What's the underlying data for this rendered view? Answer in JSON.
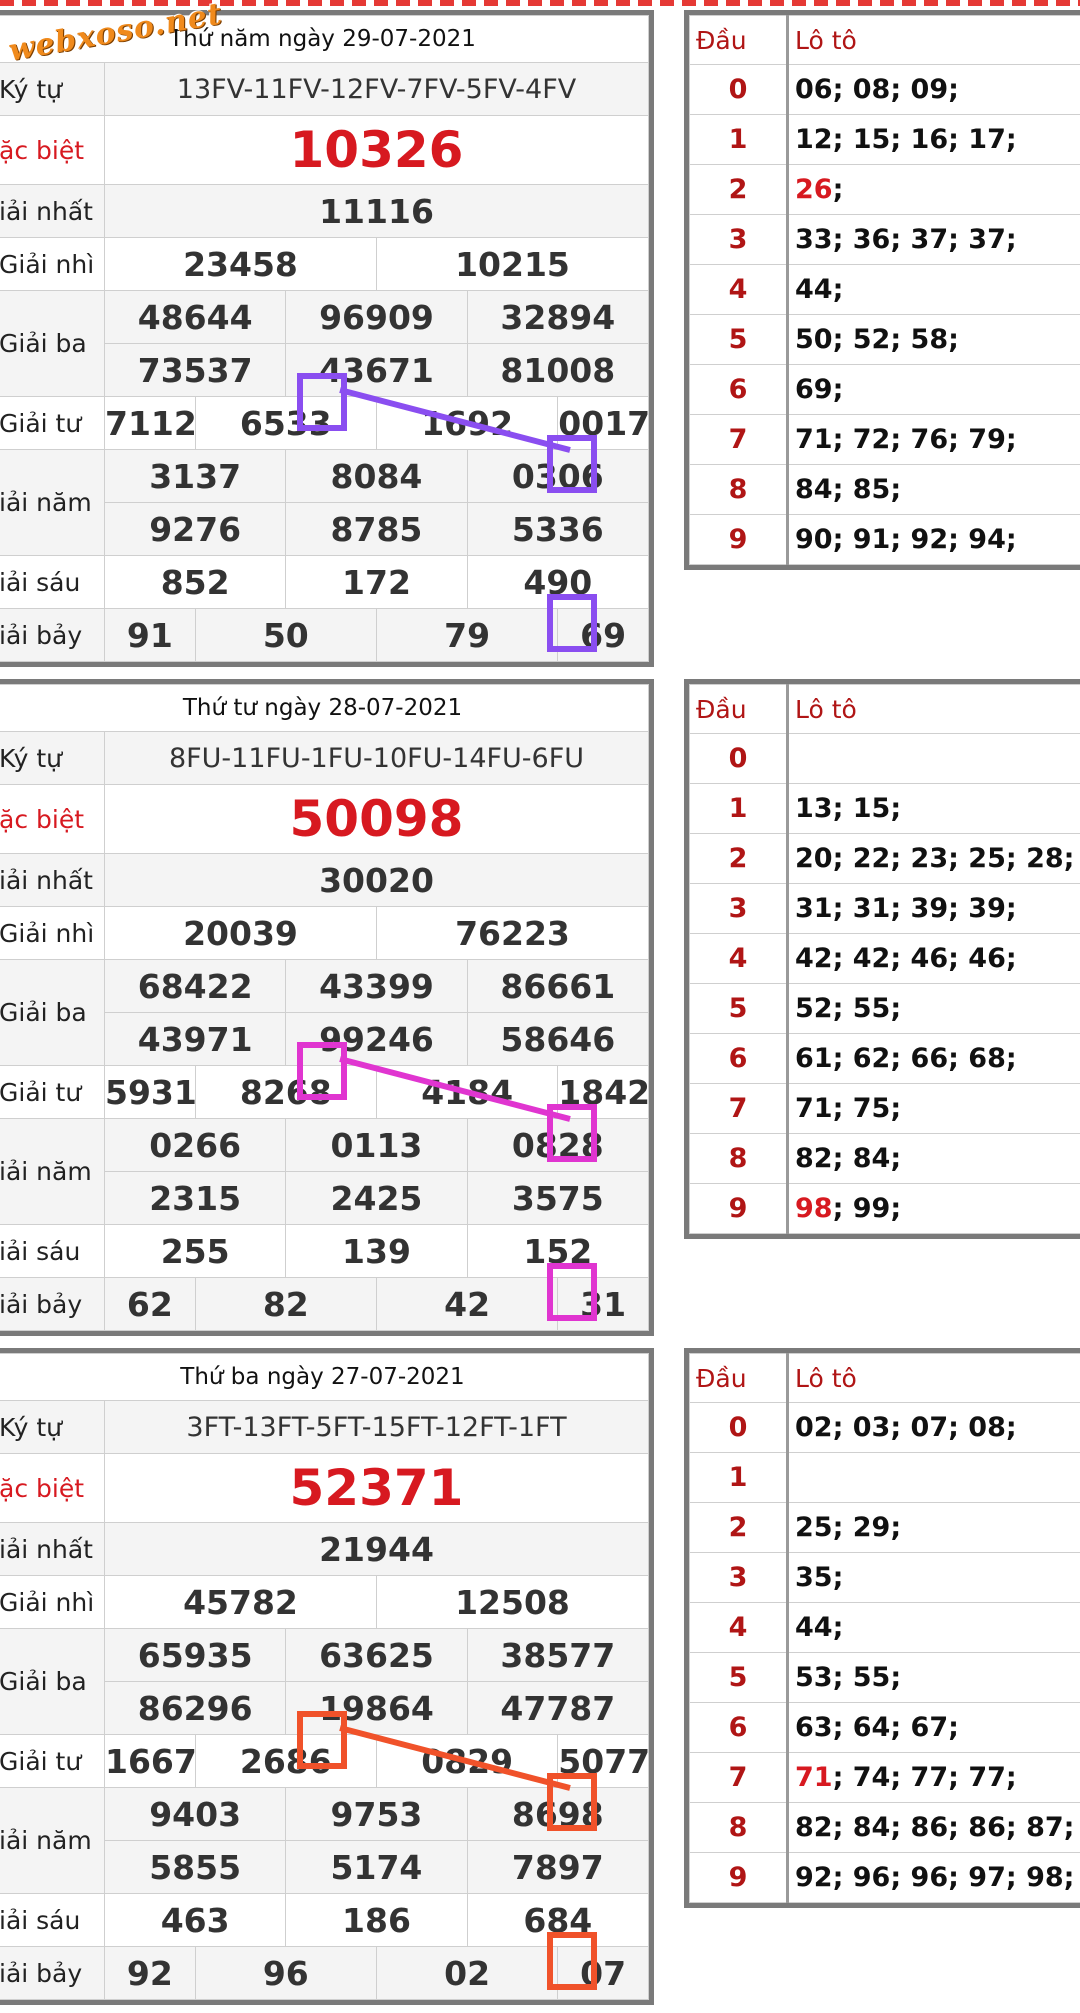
{
  "watermark": "webxoso.net",
  "colors": {
    "red": "#d71920",
    "dark_red": "#b01515",
    "purple": "#8a4ef0",
    "magenta": "#e035d0",
    "orange": "#f0522a"
  },
  "days": [
    {
      "title": "Thứ năm ngày 29-07-2021",
      "labels": {
        "ky_tu": "Ký tự",
        "dac_biet": "ặc biệt",
        "nhat": "iải nhất",
        "nhi": "Giải nhì",
        "ba": "Giải ba",
        "tu": "Giải tư",
        "nam": "iải năm",
        "sau": "iải sáu",
        "bay": "iải bảy"
      },
      "ky_tu": "13FV-11FV-12FV-7FV-5FV-4FV",
      "dac_biet": "10326",
      "nhat": "11116",
      "nhi": [
        "23458",
        "10215"
      ],
      "ba": [
        "48644",
        "96909",
        "32894",
        "73537",
        "43671",
        "81008"
      ],
      "tu": [
        "7112",
        "6533",
        "1692",
        "0017"
      ],
      "nam": [
        "3137",
        "8084",
        "0306",
        "9276",
        "8785",
        "5336"
      ],
      "sau": [
        "852",
        "172",
        "490"
      ],
      "bay": [
        "91",
        "50",
        "79",
        "69"
      ],
      "marker_color": "purple",
      "loto": {
        "head_dau": "Đầu",
        "head_loto": "Lô tô",
        "rows": [
          {
            "dau": "0",
            "first": "",
            "rest": "06; 08; 09;"
          },
          {
            "dau": "1",
            "first": "",
            "rest": "12; 15; 16; 17;"
          },
          {
            "dau": "2",
            "first": "26",
            "rest": ";"
          },
          {
            "dau": "3",
            "first": "",
            "rest": "33; 36; 37; 37;"
          },
          {
            "dau": "4",
            "first": "",
            "rest": "44;"
          },
          {
            "dau": "5",
            "first": "",
            "rest": "50; 52; 58;"
          },
          {
            "dau": "6",
            "first": "",
            "rest": "69;"
          },
          {
            "dau": "7",
            "first": "",
            "rest": "71; 72; 76; 79;"
          },
          {
            "dau": "8",
            "first": "",
            "rest": "84; 85;"
          },
          {
            "dau": "9",
            "first": "",
            "rest": "90; 91; 92; 94;"
          }
        ]
      }
    },
    {
      "title": "Thứ tư ngày 28-07-2021",
      "labels": {
        "ky_tu": "Ký tự",
        "dac_biet": "ặc biệt",
        "nhat": "iải nhất",
        "nhi": "Giải nhì",
        "ba": "Giải ba",
        "tu": "Giải tư",
        "nam": "iải năm",
        "sau": "iải sáu",
        "bay": "iải bảy"
      },
      "ky_tu": "8FU-11FU-1FU-10FU-14FU-6FU",
      "dac_biet": "50098",
      "nhat": "30020",
      "nhi": [
        "20039",
        "76223"
      ],
      "ba": [
        "68422",
        "43399",
        "86661",
        "43971",
        "99246",
        "58646"
      ],
      "tu": [
        "5931",
        "8268",
        "4184",
        "1842"
      ],
      "nam": [
        "0266",
        "0113",
        "0828",
        "2315",
        "2425",
        "3575"
      ],
      "sau": [
        "255",
        "139",
        "152"
      ],
      "bay": [
        "62",
        "82",
        "42",
        "31"
      ],
      "marker_color": "magenta",
      "loto": {
        "head_dau": "Đầu",
        "head_loto": "Lô tô",
        "rows": [
          {
            "dau": "0",
            "first": "",
            "rest": ""
          },
          {
            "dau": "1",
            "first": "",
            "rest": "13; 15;"
          },
          {
            "dau": "2",
            "first": "",
            "rest": "20; 22; 23; 25; 28;"
          },
          {
            "dau": "3",
            "first": "",
            "rest": "31; 31; 39; 39;"
          },
          {
            "dau": "4",
            "first": "",
            "rest": "42; 42; 46; 46;"
          },
          {
            "dau": "5",
            "first": "",
            "rest": "52; 55;"
          },
          {
            "dau": "6",
            "first": "",
            "rest": "61; 62; 66; 68;"
          },
          {
            "dau": "7",
            "first": "",
            "rest": "71; 75;"
          },
          {
            "dau": "8",
            "first": "",
            "rest": "82; 84;"
          },
          {
            "dau": "9",
            "first": "98",
            "rest": "; 99;"
          }
        ]
      }
    },
    {
      "title": "Thứ ba ngày 27-07-2021",
      "labels": {
        "ky_tu": "Ký tự",
        "dac_biet": "ặc biệt",
        "nhat": "iải nhất",
        "nhi": "Giải nhì",
        "ba": "Giải ba",
        "tu": "Giải tư",
        "nam": "iải năm",
        "sau": "iải sáu",
        "bay": "iải bảy"
      },
      "ky_tu": "3FT-13FT-5FT-15FT-12FT-1FT",
      "dac_biet": "52371",
      "nhat": "21944",
      "nhi": [
        "45782",
        "12508"
      ],
      "ba": [
        "65935",
        "63625",
        "38577",
        "86296",
        "19864",
        "47787"
      ],
      "tu": [
        "1667",
        "2686",
        "0829",
        "5077"
      ],
      "nam": [
        "9403",
        "9753",
        "8698",
        "5855",
        "5174",
        "7897"
      ],
      "sau": [
        "463",
        "186",
        "684"
      ],
      "bay": [
        "92",
        "96",
        "02",
        "07"
      ],
      "marker_color": "orange",
      "loto": {
        "head_dau": "Đầu",
        "head_loto": "Lô tô",
        "rows": [
          {
            "dau": "0",
            "first": "",
            "rest": "02; 03; 07; 08;"
          },
          {
            "dau": "1",
            "first": "",
            "rest": ""
          },
          {
            "dau": "2",
            "first": "",
            "rest": "25; 29;"
          },
          {
            "dau": "3",
            "first": "",
            "rest": "35;"
          },
          {
            "dau": "4",
            "first": "",
            "rest": "44;"
          },
          {
            "dau": "5",
            "first": "",
            "rest": "53; 55;"
          },
          {
            "dau": "6",
            "first": "",
            "rest": "63; 64; 67;"
          },
          {
            "dau": "7",
            "first": "71",
            "rest": "; 74; 77; 77;"
          },
          {
            "dau": "8",
            "first": "",
            "rest": "82; 84; 86; 86; 87;"
          },
          {
            "dau": "9",
            "first": "",
            "rest": "92; 96; 96; 97; 98;"
          }
        ]
      }
    }
  ]
}
